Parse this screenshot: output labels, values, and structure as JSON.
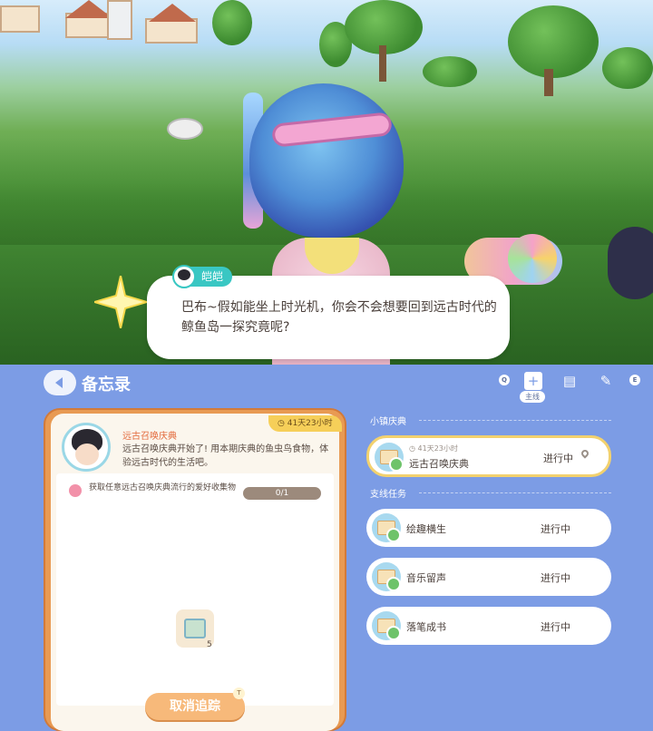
{
  "dialog": {
    "speaker": "皑皑",
    "text": "巴布~假如能坐上时光机，你会不会想要回到远古时代的鲸鱼岛一探究竟呢?"
  },
  "memo": {
    "title": "备忘录",
    "header_icons": [
      {
        "name": "q-key",
        "label": "Q"
      },
      {
        "name": "main-quest-icon",
        "label": "+"
      },
      {
        "name": "clipboard-icon",
        "label": "▤"
      },
      {
        "name": "notebook-icon",
        "label": "✎"
      },
      {
        "name": "e-key",
        "label": "E"
      }
    ],
    "main_tag": "主线"
  },
  "detail": {
    "timer": "41天23小时",
    "quest_title": "远古召唤庆典",
    "description": "远古召唤庆典开始了! 用本期庆典的鱼虫鸟食物，体验远古时代的生活吧。",
    "objective": "获取任意远古召唤庆典流行的爱好收集物",
    "progress": "0/1",
    "reward_count": "5",
    "cancel_label": "取消追踪",
    "cancel_key": "T"
  },
  "sections": {
    "town": "小镇庆典",
    "side": "支线任务"
  },
  "town_quests": [
    {
      "sub": "41天23小时",
      "name": "远古召唤庆典",
      "status": "进行中"
    }
  ],
  "side_quests": [
    {
      "name": "绘趣横生",
      "status": "进行中"
    },
    {
      "name": "音乐留声",
      "status": "进行中"
    },
    {
      "name": "落笔成书",
      "status": "进行中"
    }
  ]
}
